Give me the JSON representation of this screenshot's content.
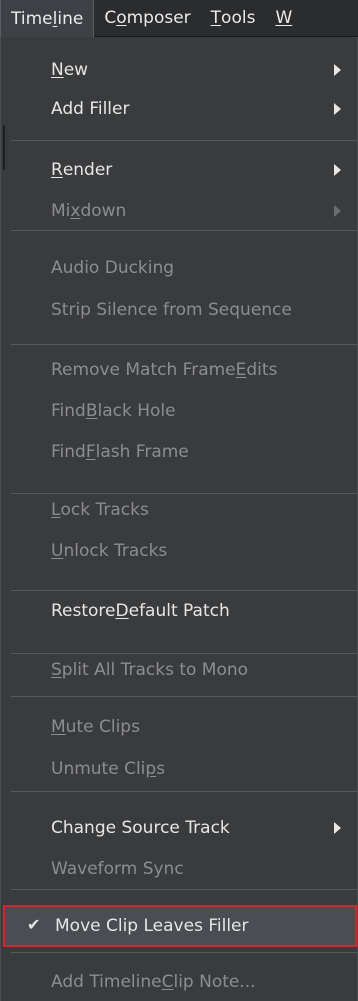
{
  "menubar": {
    "items": [
      {
        "pre": "Time",
        "u": "l",
        "post": "ine"
      },
      {
        "pre": "C",
        "u": "o",
        "post": "mposer"
      },
      {
        "pre": "",
        "u": "T",
        "post": "ools"
      },
      {
        "pre": "",
        "u": "W",
        "post": ""
      }
    ]
  },
  "menu": {
    "items": [
      {
        "pre": "",
        "u": "N",
        "post": "ew",
        "enabled": true,
        "submenu": true
      },
      {
        "pre": "Add Filler",
        "u": "",
        "post": "",
        "enabled": true,
        "submenu": true
      },
      {
        "pre": "",
        "u": "R",
        "post": "ender",
        "enabled": true,
        "submenu": true
      },
      {
        "pre": "Mi",
        "u": "x",
        "post": "down",
        "enabled": false,
        "submenu": true
      },
      {
        "pre": "Audio Ducking",
        "u": "",
        "post": "",
        "enabled": false
      },
      {
        "pre": "Strip Silence from Sequence",
        "u": "",
        "post": "",
        "enabled": false
      },
      {
        "pre": "Remove Match Frame ",
        "u": "E",
        "post": "dits",
        "enabled": false
      },
      {
        "pre": "Find ",
        "u": "B",
        "post": "lack Hole",
        "enabled": false
      },
      {
        "pre": "Find ",
        "u": "F",
        "post": "lash Frame",
        "enabled": false
      },
      {
        "pre": "",
        "u": "L",
        "post": "ock Tracks",
        "enabled": false
      },
      {
        "pre": "",
        "u": "U",
        "post": "nlock Tracks",
        "enabled": false
      },
      {
        "pre": "Restore ",
        "u": "D",
        "post": "efault Patch",
        "enabled": true
      },
      {
        "pre": "",
        "u": "S",
        "post": "plit All Tracks to Mono",
        "enabled": false
      },
      {
        "pre": "",
        "u": "M",
        "post": "ute Clips",
        "enabled": false
      },
      {
        "pre": "Unmute Cli",
        "u": "p",
        "post": "s",
        "enabled": false
      },
      {
        "pre": "Change Source Track",
        "u": "",
        "post": "",
        "enabled": true,
        "submenu": true
      },
      {
        "pre": "Waveform Sync",
        "u": "",
        "post": "",
        "enabled": false
      },
      {
        "pre": "Move Clip Leaves Filler",
        "u": "",
        "post": "",
        "enabled": true,
        "checked": true,
        "check_glyph": "✔"
      },
      {
        "pre": "Add Timeline ",
        "u": "C",
        "post": "lip Note...",
        "enabled": false
      }
    ]
  }
}
